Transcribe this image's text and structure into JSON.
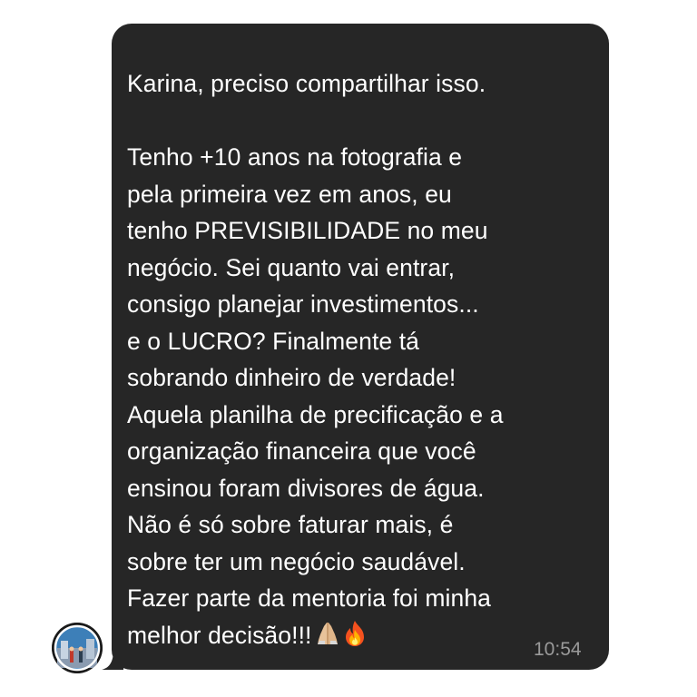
{
  "chat": {
    "message": {
      "lines": [
        "Karina, preciso compartilhar isso.",
        "",
        "Tenho +10 anos na fotografia e",
        "pela primeira vez em anos, eu",
        "tenho PREVISIBILIDADE no meu",
        "negócio. Sei quanto vai entrar,",
        "consigo planejar investimentos...",
        "e o LUCRO? Finalmente tá",
        "sobrando dinheiro de verdade!",
        "Aquela planilha de precificação e a",
        "organização financeira que você",
        "ensinou foram divisores de água.",
        "Não é só sobre faturar mais, é",
        "sobre ter um negócio saudável.",
        "Fazer parte da mentoria foi minha",
        "melhor decisão!!!"
      ],
      "emojis": [
        "folded-hands-icon",
        "fire-icon"
      ],
      "timestamp": "10:54"
    },
    "sender": {
      "avatar": "profile-photo"
    },
    "colors": {
      "bubble": "#262626",
      "text": "#ffffff",
      "timestamp": "#9a9a9a",
      "background": "#ffffff"
    }
  }
}
